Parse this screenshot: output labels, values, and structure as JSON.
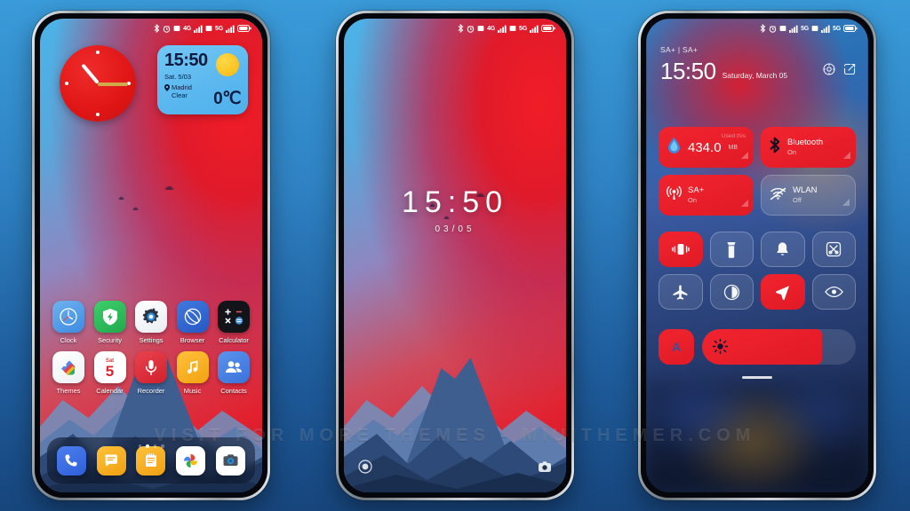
{
  "watermark": "VISIT FOR MORE THEMES - MIUITHEMER.COM",
  "theme": {
    "accent_red": "#e01a26",
    "sky_blue": "#4cb3e8",
    "widget_blue": "#5cb8ef",
    "sun_yellow": "#fcc11e",
    "page_bg": "#2f83c4"
  },
  "phone1": {
    "name": "home-screen",
    "statusbar": {
      "icons": [
        "bluetooth-icon",
        "alarm-icon",
        "sim1-signal-icon",
        "sim2-signal-icon",
        "battery-icon"
      ],
      "sim1_net": "4G",
      "sim2_net": "5G"
    },
    "clock_widget": {
      "name": "analog-clock-widget"
    },
    "weather_widget": {
      "time": "15:50",
      "date": "Sat. 5/03",
      "city": "Madrid",
      "condition": "Clear",
      "temp": "0℃",
      "icon": "sun-icon"
    },
    "apps_row1": [
      {
        "label": "Clock",
        "icon": "clock-app-icon"
      },
      {
        "label": "Security",
        "icon": "security-shield-icon"
      },
      {
        "label": "Settings",
        "icon": "settings-gear-icon"
      },
      {
        "label": "Browser",
        "icon": "browser-icon"
      },
      {
        "label": "Calculator",
        "icon": "calculator-icon"
      }
    ],
    "apps_row2": [
      {
        "label": "Themes",
        "icon": "themes-icon"
      },
      {
        "label": "Calendar",
        "icon": "calendar-icon",
        "day": "5",
        "weekday": "Sat"
      },
      {
        "label": "Recorder",
        "icon": "microphone-icon"
      },
      {
        "label": "Music",
        "icon": "music-note-icon"
      },
      {
        "label": "Contacts",
        "icon": "contacts-icon"
      }
    ],
    "page_dots": {
      "count": 4,
      "active_index": 1
    },
    "dock": [
      {
        "label": "Phone",
        "icon": "phone-icon"
      },
      {
        "label": "Messages",
        "icon": "messages-icon"
      },
      {
        "label": "Notes",
        "icon": "notes-icon"
      },
      {
        "label": "Photos",
        "icon": "photos-icon"
      },
      {
        "label": "Camera",
        "icon": "camera-icon"
      }
    ]
  },
  "phone2": {
    "name": "lock-screen",
    "statusbar": {
      "sim1_net": "4G",
      "sim2_net": "5G"
    },
    "time": "15:50",
    "date": "03/05",
    "shortcut_left": "flashlight-icon",
    "shortcut_right": "camera-icon"
  },
  "phone3": {
    "name": "control-center",
    "statusbar": {
      "sim1_net": "5G",
      "sim2_net": "5G"
    },
    "carrier": "SA+ | SA+",
    "time": "15:50",
    "date": "Saturday, March 05",
    "header_actions": [
      {
        "name": "settings-gear-icon"
      },
      {
        "name": "edit-icon"
      }
    ],
    "tiles": [
      {
        "title": "",
        "sub": "",
        "used_label": "Used this",
        "amount": "434.0",
        "unit": "MB",
        "state": "on",
        "icon": "data-drop-icon"
      },
      {
        "title": "Bluetooth",
        "sub": "On",
        "state": "on",
        "icon": "bluetooth-icon"
      },
      {
        "title": "SA+",
        "sub": "On",
        "state": "on",
        "icon": "cell-signal-icon"
      },
      {
        "title": "WLAN",
        "sub": "Off",
        "state": "off",
        "icon": "wifi-off-icon"
      }
    ],
    "buttons": [
      {
        "name": "vibrate-icon",
        "state": "on"
      },
      {
        "name": "flashlight-icon",
        "state": "off"
      },
      {
        "name": "bell-icon",
        "state": "off"
      },
      {
        "name": "screenshot-icon",
        "state": "off"
      },
      {
        "name": "airplane-icon",
        "state": "off"
      },
      {
        "name": "dark-mode-icon",
        "state": "off"
      },
      {
        "name": "location-icon",
        "state": "on"
      },
      {
        "name": "eye-care-icon",
        "state": "off"
      }
    ],
    "auto_rotate": {
      "label": "A",
      "icon": "auto-rotate-icon",
      "state": "on"
    },
    "brightness": {
      "icon": "brightness-icon",
      "percent": 78
    }
  }
}
